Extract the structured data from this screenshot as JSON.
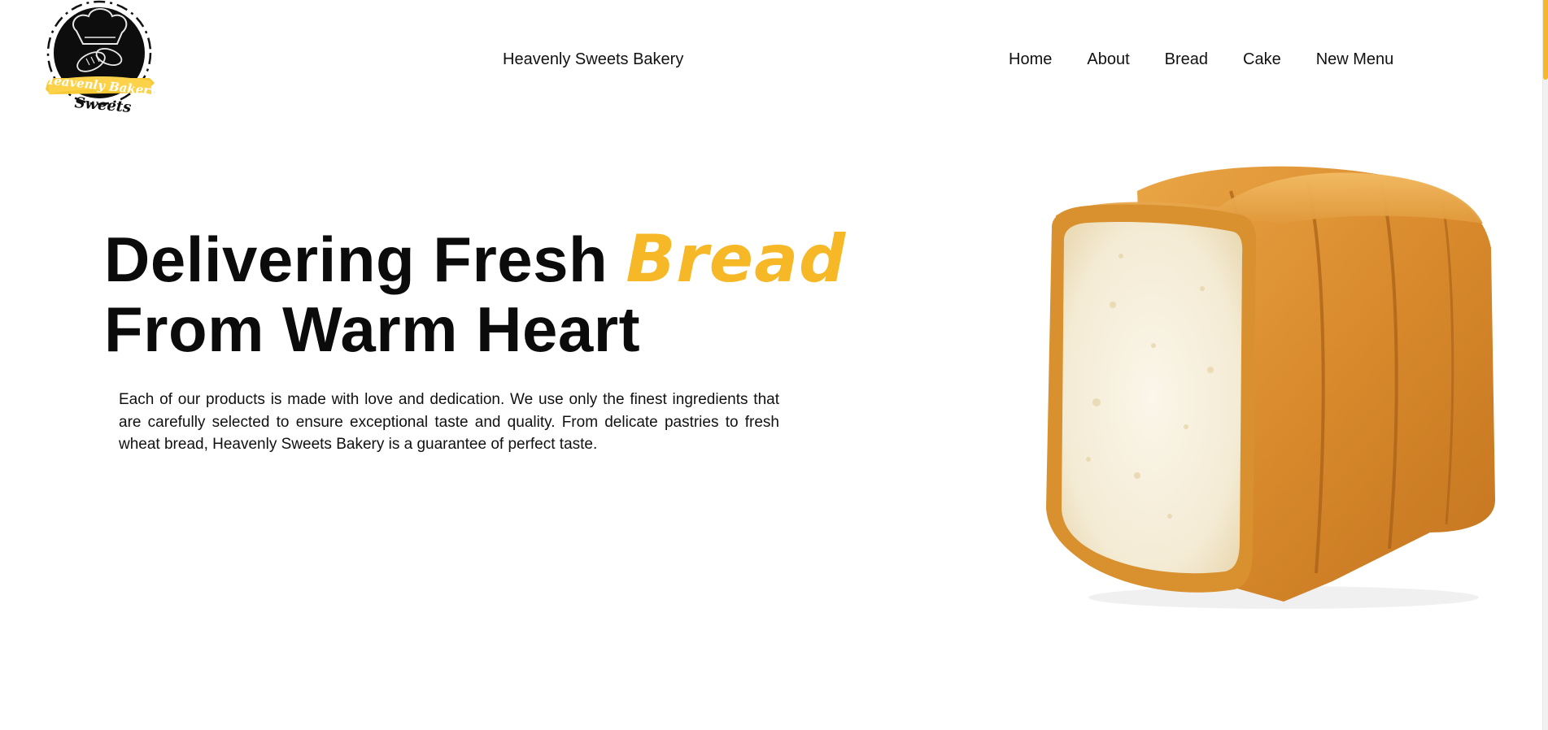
{
  "header": {
    "logo": {
      "icon": "chef-hat-bread-logo",
      "text_line1": "Heavenly Bakery",
      "text_line2": "Sweets"
    },
    "brand_title": "Heavenly Sweets Bakery",
    "nav": [
      {
        "label": "Home"
      },
      {
        "label": "About"
      },
      {
        "label": "Bread"
      },
      {
        "label": "Cake"
      },
      {
        "label": "New Menu"
      }
    ]
  },
  "hero": {
    "title_part1": "Delivering Fresh ",
    "title_accent": "Bread",
    "title_line2": "From Warm Heart",
    "description": "Each of our products is made with love and dedication. We use only the finest ingredients that are carefully selected to ensure exceptional taste and quality. From delicate pastries to fresh wheat bread, Heavenly Sweets Bakery is a guarantee of perfect taste.",
    "image": "sliced-bread-loaf"
  },
  "colors": {
    "accent": "#f7b827",
    "text": "#0b0b0b",
    "background": "#ffffff"
  }
}
